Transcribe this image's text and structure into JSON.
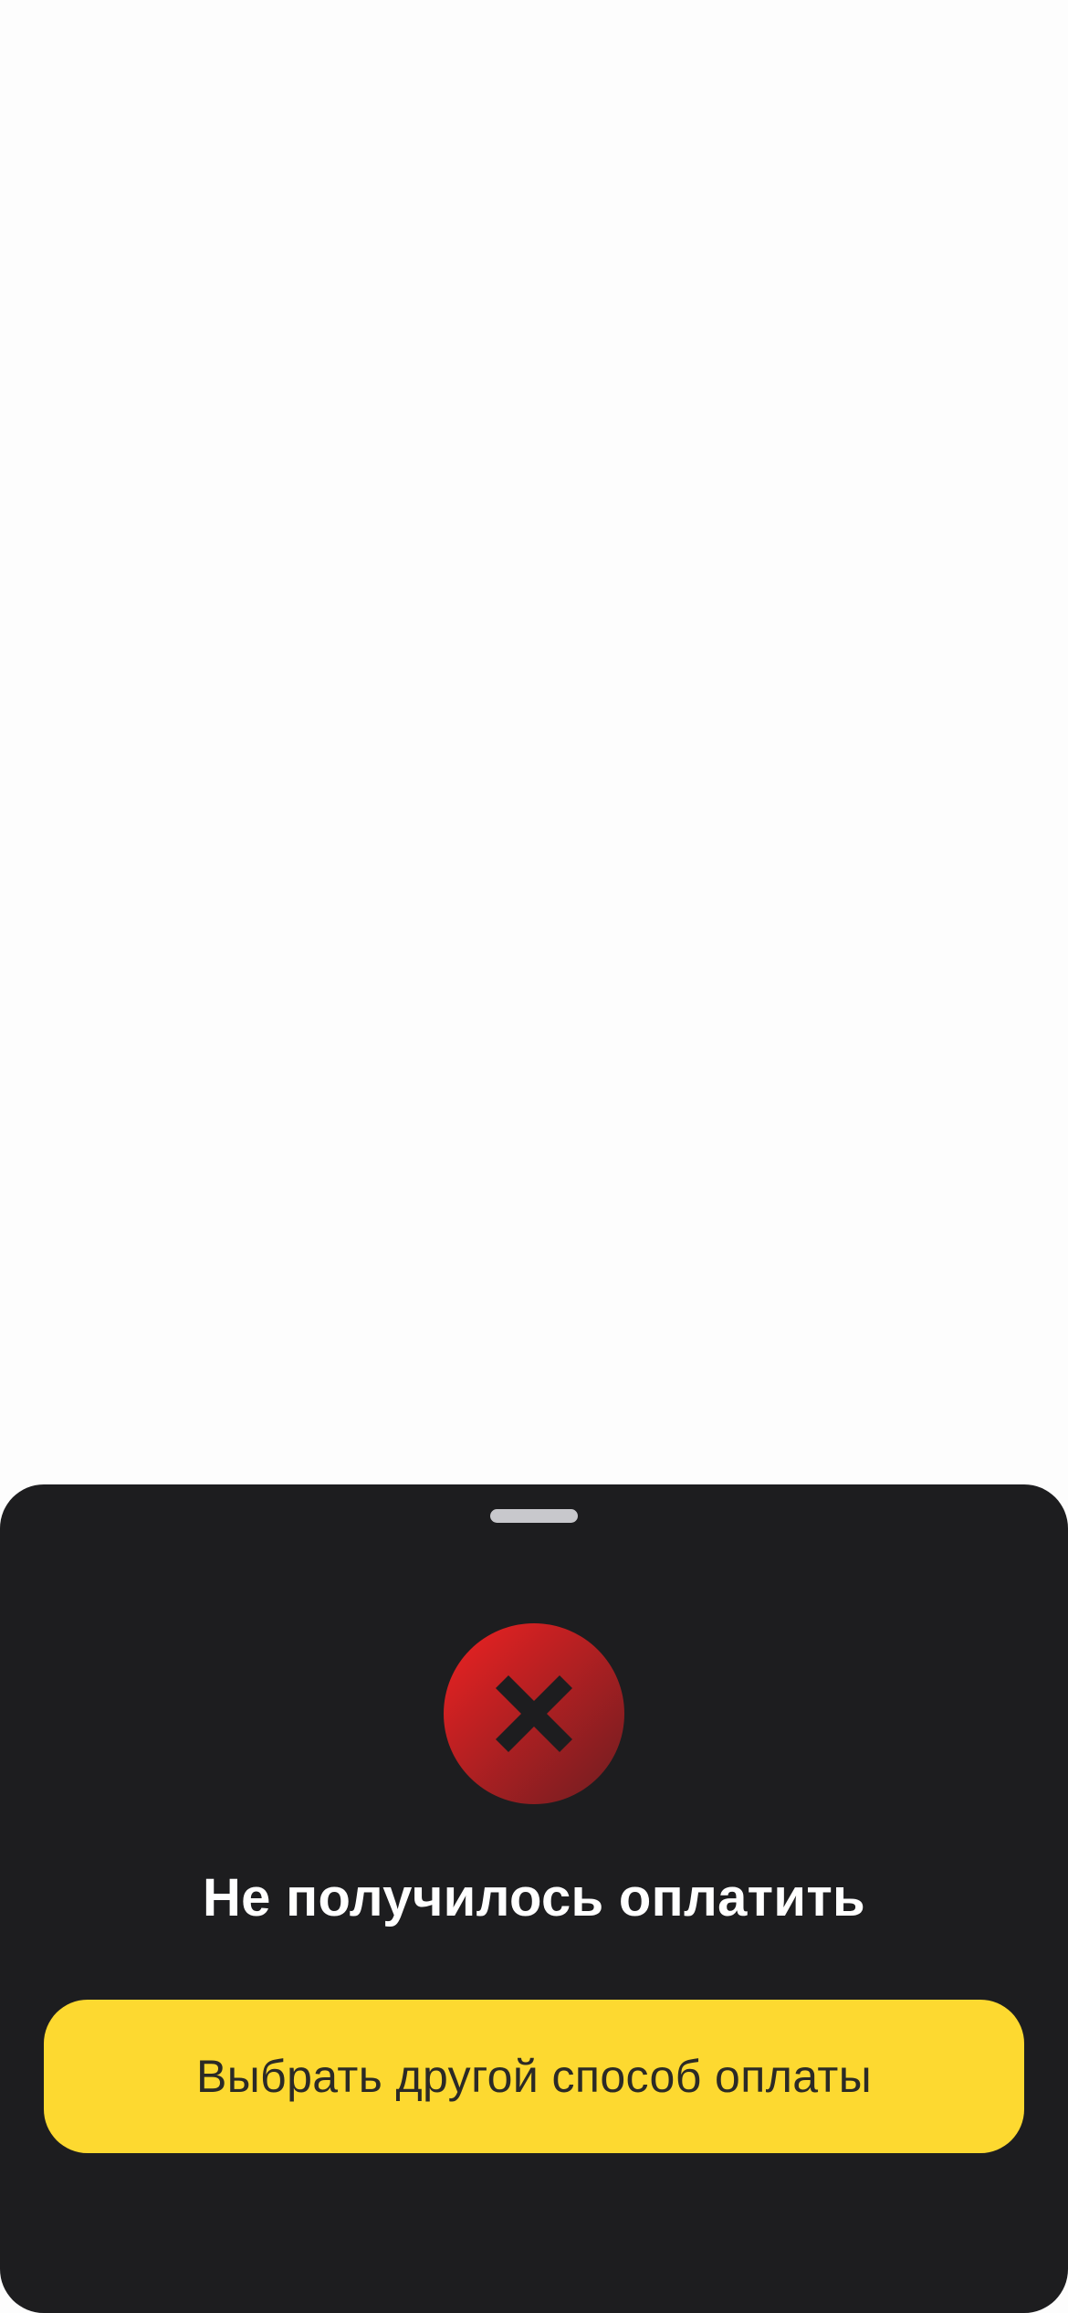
{
  "sheet": {
    "title": "Не получилось оплатить",
    "status_icon": "error-x-circle-icon",
    "primary_button_label": "Выбрать другой способ оплаты"
  },
  "colors": {
    "background": "#fdfdfd",
    "sheet_background": "#1d1d1f",
    "error_gradient_start": "#e42424",
    "error_gradient_end": "#7a1c20",
    "button_accent": "#fdd930",
    "button_text": "#2b2a26",
    "title_text": "#ffffff"
  }
}
